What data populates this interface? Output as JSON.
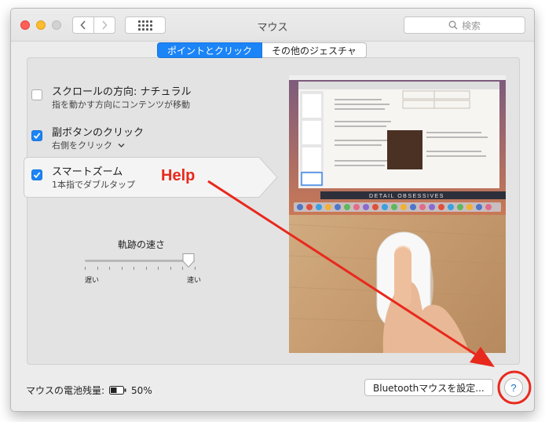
{
  "window": {
    "title": "マウス"
  },
  "search": {
    "placeholder": "検索"
  },
  "tabs": [
    {
      "label": "ポイントとクリック",
      "active": true
    },
    {
      "label": "その他のジェスチャ",
      "active": false
    }
  ],
  "options": [
    {
      "title": "スクロールの方向: ナチュラル",
      "subtitle": "指を動かす方向にコンテンツが移動",
      "checked": false
    },
    {
      "title": "副ボタンのクリック",
      "subtitle": "右側をクリック",
      "checked": true,
      "has_dropdown": true
    },
    {
      "title": "スマートズーム",
      "subtitle": "1本指でダブルタップ",
      "checked": true,
      "selected": true
    }
  ],
  "tracking": {
    "label": "軌跡の速さ",
    "min_label": "遅い",
    "max_label": "速い",
    "value_fraction": 0.94
  },
  "preview": {
    "banner": "DETAIL OBSESSIVES"
  },
  "battery": {
    "label": "マウスの電池残量:",
    "value": "50%",
    "level_fraction": 0.5
  },
  "buttons": {
    "bluetooth": "Bluetoothマウスを設定...",
    "help": "?"
  },
  "annotation": {
    "text": "Help",
    "color": "#e8291d"
  },
  "colors": {
    "accent": "#1b84f7"
  }
}
